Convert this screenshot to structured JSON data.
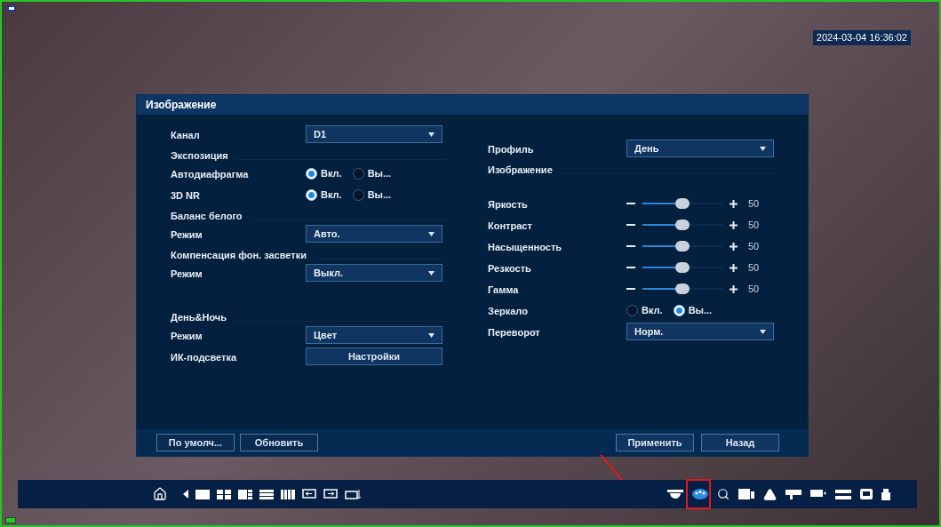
{
  "clock": "2024-03-04 16:36:02",
  "dialog": {
    "title": "Изображение",
    "left": [
      {
        "kind": "select",
        "label": "Канал",
        "value": "D1"
      },
      {
        "kind": "section",
        "label": "Экспозиция"
      },
      {
        "kind": "radio",
        "label": "Автодиафрагма",
        "options": [
          {
            "label": "Вкл.",
            "selected": true
          },
          {
            "label": "Вы...",
            "selected": false
          }
        ]
      },
      {
        "kind": "radio",
        "label": "3D NR",
        "options": [
          {
            "label": "Вкл.",
            "selected": true
          },
          {
            "label": "Вы...",
            "selected": false
          }
        ]
      },
      {
        "kind": "section",
        "label": "Баланс белого"
      },
      {
        "kind": "select",
        "label": "Режим",
        "value": "Авто."
      },
      {
        "kind": "section",
        "label": "Компенсация фон. засветки"
      },
      {
        "kind": "select",
        "label": "Режим",
        "value": "Выкл."
      },
      {
        "kind": "section",
        "label": "День&Ночь"
      },
      {
        "kind": "select",
        "label": "Режим",
        "value": "Цвет"
      },
      {
        "kind": "button",
        "label": "ИК-подсветка",
        "value": "Настройки"
      }
    ],
    "right": [
      {
        "kind": "select",
        "label": "Профиль",
        "value": "День"
      },
      {
        "kind": "section",
        "label": "Изображение"
      },
      {
        "kind": "slider",
        "label": "Яркость",
        "level": 0.5,
        "reading": "50"
      },
      {
        "kind": "slider",
        "label": "Контраст",
        "level": 0.5,
        "reading": "50"
      },
      {
        "kind": "slider",
        "label": "Насыщенность",
        "level": 0.5,
        "reading": "50"
      },
      {
        "kind": "slider",
        "label": "Резкость",
        "level": 0.5,
        "reading": "50"
      },
      {
        "kind": "slider",
        "label": "Гамма",
        "level": 0.5,
        "reading": "50"
      },
      {
        "kind": "radio",
        "label": "Зеркало",
        "options": [
          {
            "label": "Вкл.",
            "selected": false
          },
          {
            "label": "Вы...",
            "selected": true
          }
        ]
      },
      {
        "kind": "select",
        "label": "Переворот",
        "value": "Норм."
      }
    ],
    "footer_left": [
      "По умолч...",
      "Обновить"
    ],
    "footer_right": [
      "Применить",
      "Назад"
    ]
  }
}
